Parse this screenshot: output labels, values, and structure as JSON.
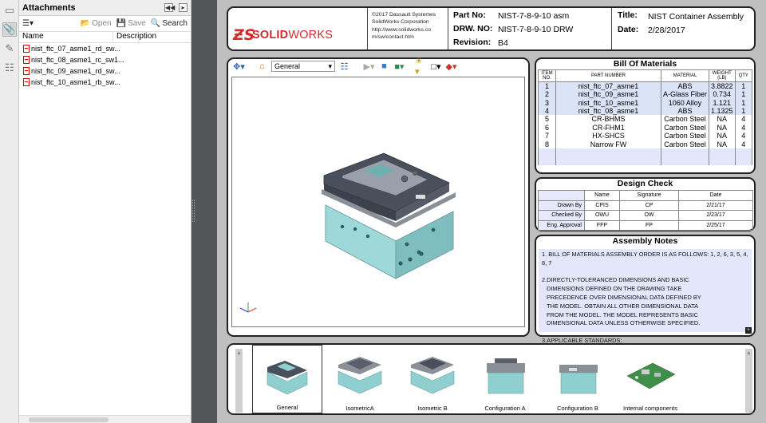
{
  "attachments_panel": {
    "title": "Attachments",
    "toolbar": {
      "open_label": "Open",
      "save_label": "Save",
      "search_label": "Search"
    },
    "columns": {
      "name": "Name",
      "description": "Description"
    },
    "files": [
      "nist_ftc_07_asme1_rd_sw...",
      "nist_ftc_08_asme1_rc_sw1...",
      "nist_ftc_09_asme1_rd_sw...",
      "nist_ftc_10_asme1_rb_sw..."
    ]
  },
  "title_block": {
    "logo_ds": "ƵS",
    "logo_solid": "SOLID",
    "logo_works": "WORKS",
    "copyright_lines": [
      "©2017 Dassault Systemes",
      "SolidWorks Corporation",
      "http://www.solidworks.co",
      "m/sw/contact.htm"
    ],
    "part_no_label": "Part No:",
    "part_no": "NIST-7-8-9-10 asm",
    "drw_no_label": "DRW. NO:",
    "drw_no": "NIST-7-8-9-10 DRW",
    "revision_label": "Revision:",
    "revision": "B4",
    "title_label": "Title:",
    "title": "NIST Container Assembly",
    "date_label": "Date:",
    "date": "2/28/2017"
  },
  "viewer": {
    "view_select": "General"
  },
  "bom": {
    "title": "Bill Of Materials",
    "headers": {
      "item": "ITEM NO.",
      "part": "PART NUMBER",
      "material": "MATERIAL",
      "weight": "WEIGHT (LB)",
      "qty": "QTY"
    },
    "rows": [
      {
        "item": "1",
        "part": "nist_ftc_07_asme1",
        "material": "ABS",
        "weight": "3.8822",
        "qty": "1"
      },
      {
        "item": "2",
        "part": "nist_ftc_09_asme1",
        "material": "A-Glass Fiber",
        "weight": "0.734",
        "qty": "1"
      },
      {
        "item": "3",
        "part": "nist_ftc_10_asme1",
        "material": "1060 Alloy",
        "weight": "1.121",
        "qty": "1"
      },
      {
        "item": "4",
        "part": "nist_ftc_08_asme1",
        "material": "ABS",
        "weight": "1.1325",
        "qty": "1"
      },
      {
        "item": "5",
        "part": "CR-BHMS",
        "material": "Carbon Steel",
        "weight": "NA",
        "qty": "4"
      },
      {
        "item": "6",
        "part": "CR-FHM1",
        "material": "Carbon Steel",
        "weight": "NA",
        "qty": "4"
      },
      {
        "item": "7",
        "part": "HX-SHCS",
        "material": "Carbon Steel",
        "weight": "NA",
        "qty": "4"
      },
      {
        "item": "8",
        "part": "Narrow FW",
        "material": "Carbon Steel",
        "weight": "NA",
        "qty": "4"
      }
    ]
  },
  "design_check": {
    "title": "Design Check",
    "headers": [
      "Name",
      "Signature",
      "Date"
    ],
    "rows": [
      {
        "role": "Drawn By",
        "name": "CPIS",
        "signature": "CP",
        "date": "2/21/17"
      },
      {
        "role": "Checked By",
        "name": "OWU",
        "signature": "OW",
        "date": "2/23/17"
      },
      {
        "role": "Eng. Approval",
        "name": "FFP",
        "signature": "FP",
        "date": "2/25/17"
      }
    ]
  },
  "assembly_notes": {
    "title": "Assembly Notes",
    "lines": [
      "1. BILL OF MATERIALS ASSEMBLY ORDER IS AS FOLLOWS: 1, 2, 6, 3, 5, 4, 8, 7",
      "",
      "2.DIRECTLY-TOLERANCED DIMENSIONS AND BASIC",
      "DIMENSIONS DEFINED ON THE DRAWING TAKE",
      "PRECEDENCE OVER DIMENSIONAL DATA DEFINED BY",
      "THE MODEL. OBTAIN ALL OTHER DIMENSIONAL DATA",
      "FROM THE MODEL. THE MODEL REPRESENTS BASIC",
      "DIMENSIONAL DATA UNLESS OTHERWISE SPECIFIED.",
      "",
      "3.APPLICABLE STANDARDS:"
    ]
  },
  "views": [
    {
      "label": "General",
      "selected": true
    },
    {
      "label": "IsometricA",
      "selected": false
    },
    {
      "label": "Isometric B",
      "selected": false
    },
    {
      "label": "Configuration A",
      "selected": false
    },
    {
      "label": "Configuration B",
      "selected": false
    },
    {
      "label": "Internal components",
      "selected": false
    }
  ],
  "colors": {
    "teal": "#8fcfcf",
    "dark_lid": "#4a4f5c",
    "brand_red": "#d12a2a",
    "highlight": "#dbe3f7"
  }
}
